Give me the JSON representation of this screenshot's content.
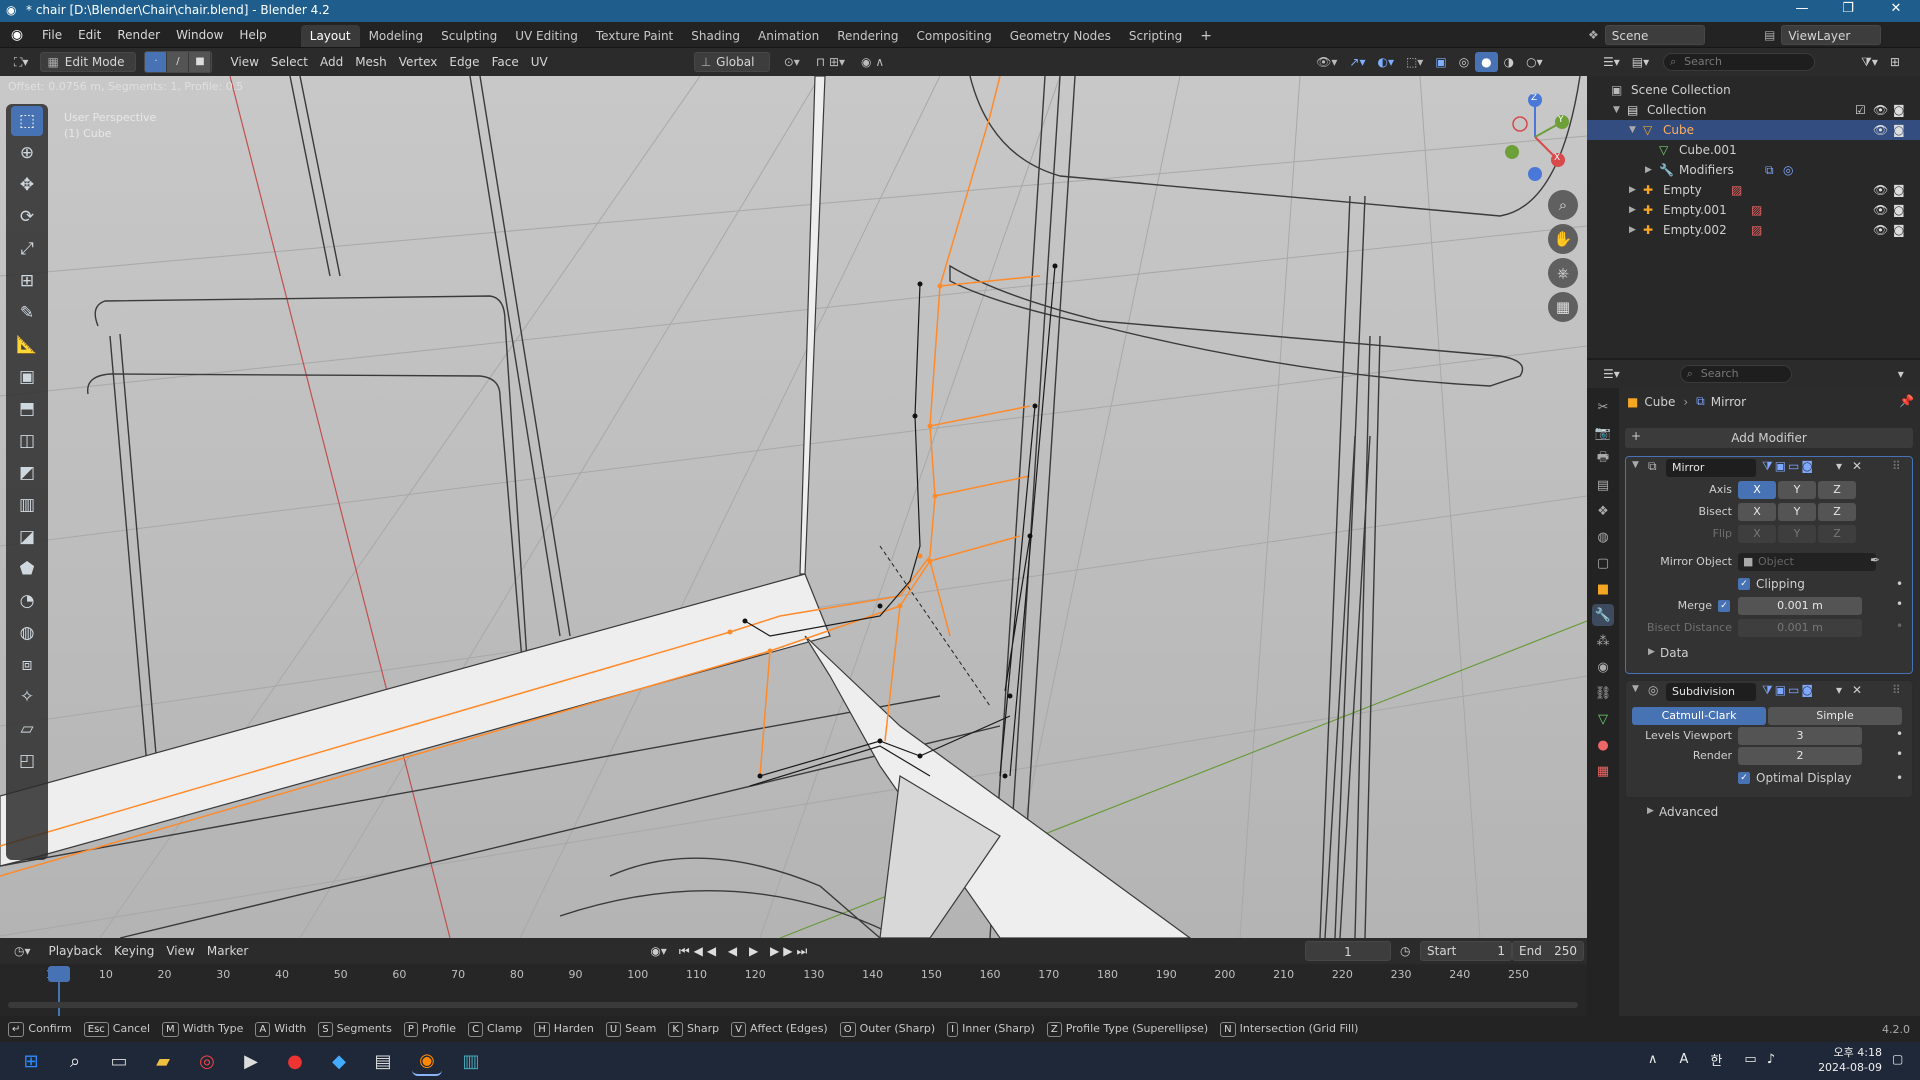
{
  "window": {
    "title": "* chair [D:\\Blender\\Chair\\chair.blend] - Blender 4.2"
  },
  "menu": {
    "items": [
      "File",
      "Edit",
      "Render",
      "Window",
      "Help"
    ],
    "workspaces": [
      "Layout",
      "Modeling",
      "Sculpting",
      "UV Editing",
      "Texture Paint",
      "Shading",
      "Animation",
      "Rendering",
      "Compositing",
      "Geometry Nodes",
      "Scripting"
    ],
    "scene": "Scene",
    "viewlayer": "ViewLayer"
  },
  "viewport_header": {
    "mode": "Edit Mode",
    "menus": [
      "View",
      "Select",
      "Add",
      "Mesh",
      "Vertex",
      "Edge",
      "Face",
      "UV"
    ],
    "orientation": "Global"
  },
  "viewport": {
    "operator_info": "Offset: 0.0756 m, Segments: 1, Profile: 0.5",
    "perspective": "User Perspective",
    "object": "(1) Cube",
    "gizmo": {
      "z": "Z",
      "y": "Y",
      "x": "X"
    }
  },
  "outliner": {
    "search_placeholder": "Search",
    "rows": [
      {
        "label": "Scene Collection"
      },
      {
        "label": "Collection"
      },
      {
        "label": "Cube"
      },
      {
        "label": "Cube.001"
      },
      {
        "label": "Modifiers"
      },
      {
        "label": "Empty"
      },
      {
        "label": "Empty.001"
      },
      {
        "label": "Empty.002"
      }
    ]
  },
  "properties": {
    "search_placeholder": "Search",
    "breadcrumb": {
      "object": "Cube",
      "modifier": "Mirror"
    },
    "add_modifier": "Add Modifier",
    "mirror": {
      "name": "Mirror",
      "axis_label": "Axis",
      "bisect_label": "Bisect",
      "flip_label": "Flip",
      "axes": [
        "X",
        "Y",
        "Z"
      ],
      "mirror_object_label": "Mirror Object",
      "mirror_object_placeholder": "Object",
      "clipping_label": "Clipping",
      "merge_label": "Merge",
      "merge_value": "0.001 m",
      "bisect_distance_label": "Bisect Distance",
      "bisect_distance_value": "0.001 m",
      "data_label": "Data"
    },
    "subdivision": {
      "name": "Subdivision",
      "catmull": "Catmull-Clark",
      "simple": "Simple",
      "levels_viewport_label": "Levels Viewport",
      "levels_viewport_value": "3",
      "render_label": "Render",
      "render_value": "2",
      "optimal_display_label": "Optimal Display",
      "advanced_label": "Advanced"
    }
  },
  "timeline": {
    "menus": [
      "Playback",
      "Keying",
      "View",
      "Marker"
    ],
    "current_frame": "1",
    "start_label": "Start",
    "start_value": "1",
    "end_label": "End",
    "end_value": "250",
    "ticks": [
      "1",
      "10",
      "20",
      "30",
      "40",
      "50",
      "60",
      "70",
      "80",
      "90",
      "100",
      "110",
      "120",
      "130",
      "140",
      "150",
      "160",
      "170",
      "180",
      "190",
      "200",
      "210",
      "220",
      "230",
      "240",
      "250"
    ]
  },
  "statusbar": {
    "items": [
      {
        "key": "↵",
        "label": "Confirm"
      },
      {
        "key": "Esc",
        "label": "Cancel"
      },
      {
        "key": "M",
        "label": "Width Type"
      },
      {
        "key": "A",
        "label": "Width"
      },
      {
        "key": "S",
        "label": "Segments"
      },
      {
        "key": "P",
        "label": "Profile"
      },
      {
        "key": "C",
        "label": "Clamp"
      },
      {
        "key": "H",
        "label": "Harden"
      },
      {
        "key": "U",
        "label": "Seam"
      },
      {
        "key": "K",
        "label": "Sharp"
      },
      {
        "key": "V",
        "label": "Affect (Edges)"
      },
      {
        "key": "O",
        "label": "Outer (Sharp)"
      },
      {
        "key": "I",
        "label": "Inner (Sharp)"
      },
      {
        "key": "Z",
        "label": "Profile Type (Superellipse)"
      },
      {
        "key": "N",
        "label": "Intersection (Grid Fill)"
      }
    ],
    "version": "4.2.0"
  },
  "taskbar": {
    "lang": "A",
    "ime": "한",
    "time": "오후 4:18",
    "date": "2024-08-09"
  },
  "colors": {
    "accent": "#4772b3",
    "selection": "#ff8a2a",
    "x_axis": "#c84a4a",
    "y_axis": "#6a9a3a"
  }
}
